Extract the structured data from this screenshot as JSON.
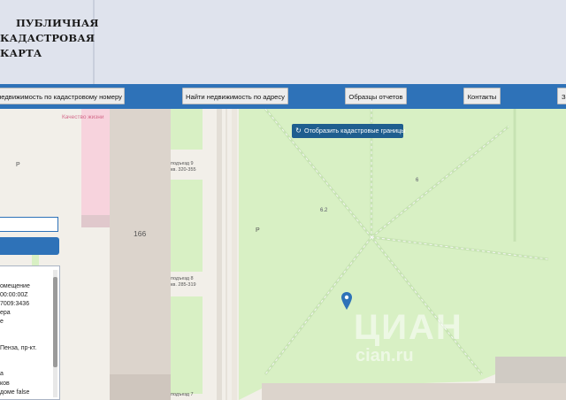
{
  "logo": {
    "line1": "ПУБЛИЧНАЯ",
    "line2": "КАДАСТРОВАЯ КАРТА"
  },
  "nav": {
    "items": [
      "недвижимость по кадастровому номеру",
      "Найти недвижимость по адресу",
      "Образцы отчетов",
      "Контакты",
      "З"
    ]
  },
  "map": {
    "show_borders_button": "Отобразить кадастровые границы",
    "labels": {
      "kachestvo": "Качество жизни",
      "house_number": "166",
      "p_left": "Р",
      "p_mid": "Р",
      "entrance9": "подъезд 9",
      "entrance9_flats": "кв. 320-355",
      "entrance8": "подъезд 8",
      "entrance8_flats": "кв. 285-319",
      "entrance7": "подъезд 7",
      "park_code1": "6",
      "park_code2": "6.2",
      "watermark": "ЦИАН",
      "watermark_sub": "cian.ru"
    }
  },
  "info_panel": {
    "lines": [
      "омещение",
      "00:00:00Z",
      "7009:3436",
      "ера",
      "е",
      "",
      "Пенза, пр-кт.",
      "",
      "а",
      "ков",
      "доме false"
    ]
  },
  "colors": {
    "nav_bar": "#2e72b8",
    "button_dark": "#1f5e8f",
    "park": "#d8f0c4",
    "building": "#dcd4cc"
  }
}
